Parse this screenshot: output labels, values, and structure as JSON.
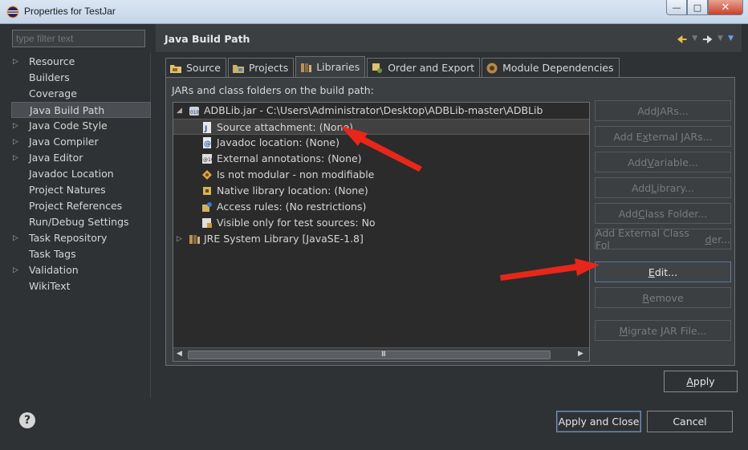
{
  "window": {
    "title": "Properties for TestJar",
    "controls": {
      "minimize": "—",
      "maximize": "□",
      "close": "✕"
    }
  },
  "left_panel": {
    "filter_placeholder": "type filter text",
    "items": [
      {
        "label": "Resource",
        "expandable": true
      },
      {
        "label": "Builders",
        "expandable": false
      },
      {
        "label": "Coverage",
        "expandable": false
      },
      {
        "label": "Java Build Path",
        "expandable": false,
        "selected": true
      },
      {
        "label": "Java Code Style",
        "expandable": true
      },
      {
        "label": "Java Compiler",
        "expandable": true
      },
      {
        "label": "Java Editor",
        "expandable": true
      },
      {
        "label": "Javadoc Location",
        "expandable": false
      },
      {
        "label": "Project Natures",
        "expandable": false
      },
      {
        "label": "Project References",
        "expandable": false
      },
      {
        "label": "Run/Debug Settings",
        "expandable": false
      },
      {
        "label": "Task Repository",
        "expandable": true
      },
      {
        "label": "Task Tags",
        "expandable": false
      },
      {
        "label": "Validation",
        "expandable": true
      },
      {
        "label": "WikiText",
        "expandable": false
      }
    ]
  },
  "page": {
    "title": "Java Build Path",
    "tabs": [
      {
        "label": "Source",
        "icon": "source-folder-icon"
      },
      {
        "label": "Projects",
        "icon": "projects-icon"
      },
      {
        "label": "Libraries",
        "icon": "libraries-icon",
        "active": true
      },
      {
        "label": "Order and Export",
        "icon": "order-export-icon"
      },
      {
        "label": "Module Dependencies",
        "icon": "module-icon"
      }
    ],
    "body_label": "JARs and class folders on the build path:",
    "tree": [
      {
        "text": "ADBLib.jar - C:\\Users\\Administrator\\Desktop\\ADBLib-master\\ADBLib",
        "level": 0,
        "expanded": true,
        "icon": "jar-icon"
      },
      {
        "text": "Source attachment: (None)",
        "level": 1,
        "icon": "source-attachment-icon",
        "selected": true
      },
      {
        "text": "Javadoc location: (None)",
        "level": 1,
        "icon": "javadoc-icon"
      },
      {
        "text": "External annotations: (None)",
        "level": 1,
        "icon": "annotations-icon"
      },
      {
        "text": "Is not modular - non modifiable",
        "level": 1,
        "icon": "module-info-icon"
      },
      {
        "text": "Native library location: (None)",
        "level": 1,
        "icon": "native-library-icon"
      },
      {
        "text": "Access rules: (No restrictions)",
        "level": 1,
        "icon": "access-rules-icon"
      },
      {
        "text": "Visible only for test sources: No",
        "level": 1,
        "icon": "test-sources-icon"
      },
      {
        "text": "JRE System Library [JavaSE-1.8]",
        "level": 0,
        "expanded": false,
        "icon": "library-icon"
      }
    ],
    "scroll_grip": "III",
    "buttons": [
      {
        "pre": "Add ",
        "mn": "J",
        "post": "ARs...",
        "enabled": false
      },
      {
        "pre": "Add E",
        "mn": "x",
        "post": "ternal JARs...",
        "enabled": false
      },
      {
        "pre": "Add ",
        "mn": "V",
        "post": "ariable...",
        "enabled": false
      },
      {
        "pre": "Add ",
        "mn": "L",
        "post": "ibrary...",
        "enabled": false
      },
      {
        "pre": "Add ",
        "mn": "C",
        "post": "lass Folder...",
        "enabled": false
      },
      {
        "pre": "Add External Class Fol",
        "mn": "d",
        "post": "er...",
        "enabled": false
      },
      {
        "pre": "",
        "mn": "E",
        "post": "dit...",
        "enabled": true
      },
      {
        "pre": "",
        "mn": "R",
        "post": "emove",
        "enabled": false
      },
      {
        "pre": "",
        "mn": "M",
        "post": "igrate JAR File...",
        "enabled": false
      }
    ],
    "apply": {
      "pre": "",
      "mn": "A",
      "post": "pply"
    }
  },
  "footer": {
    "help": "?",
    "apply_close": "Apply and Close",
    "cancel": "Cancel"
  },
  "colors": {
    "background": "#2f3234",
    "panel": "#3b3f42",
    "annotation_arrow": "#e8261a"
  }
}
